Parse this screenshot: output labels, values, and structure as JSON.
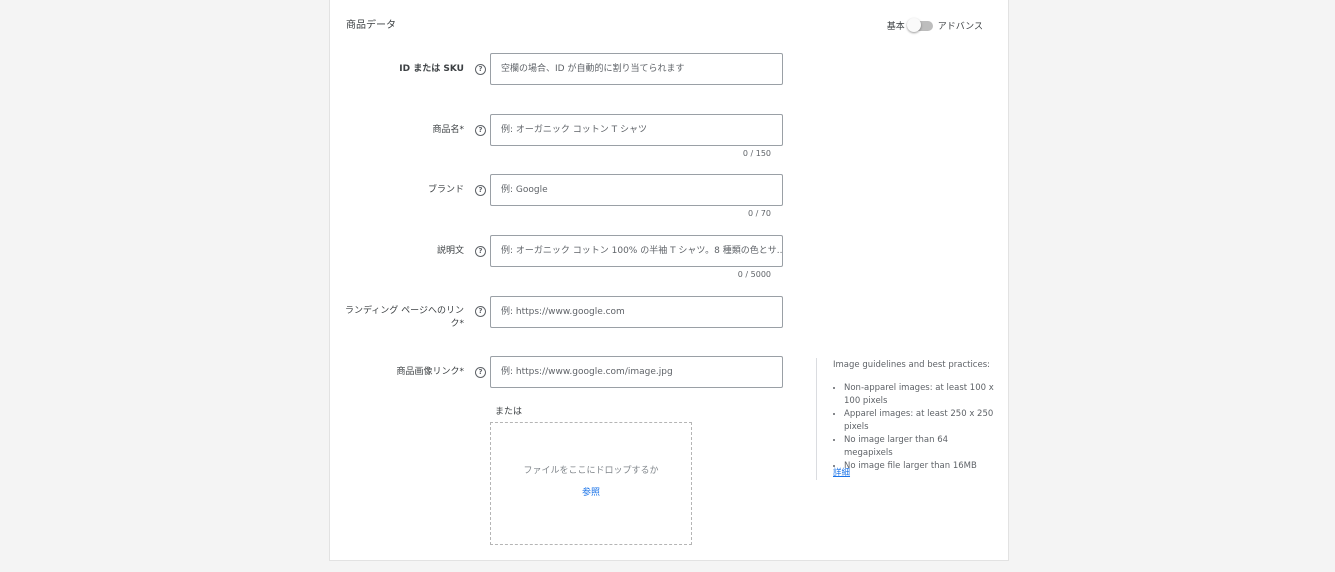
{
  "section": {
    "title": "商品データ"
  },
  "mode_toggle": {
    "basic_label": "基本",
    "advanced_label": "アドバンス"
  },
  "fields": {
    "id_sku": {
      "label": "ID または SKU",
      "placeholder": "空欄の場合、ID が自動的に割り当てられます"
    },
    "product_name": {
      "label": "商品名*",
      "placeholder": "例: オーガニック コットン T シャツ",
      "counter": "0 / 150"
    },
    "brand": {
      "label": "ブランド",
      "placeholder": "例: Google",
      "counter": "0 / 70"
    },
    "description": {
      "label": "説明文",
      "placeholder": "例: オーガニック コットン 100% の半袖 T シャツ。8 種類の色とサ...",
      "counter": "0 / 5000"
    },
    "landing_page": {
      "label": "ランディング ページへのリンク*",
      "placeholder": "例: https://www.google.com"
    },
    "image_link": {
      "label": "商品画像リンク*",
      "placeholder": "例: https://www.google.com/image.jpg"
    }
  },
  "help_icon_glyph": "?",
  "upload": {
    "or_text": "または",
    "drop_text": "ファイルをここにドロップするか",
    "browse_label": "参照"
  },
  "guidelines": {
    "title": "Image guidelines and best practices:",
    "items": [
      "Non-apparel images: at least 100 x 100 pixels",
      "Apparel images: at least 250 x 250 pixels",
      "No image larger than 64 megapixels",
      "No image file larger than 16MB"
    ],
    "details_link": "詳細"
  },
  "colors": {
    "link": "#1a73e8",
    "border": "#9aa0a6",
    "background": "#f4f4f4"
  }
}
